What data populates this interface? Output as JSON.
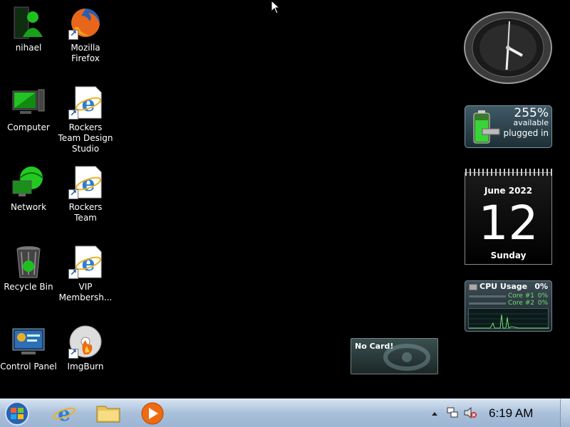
{
  "desktop": {
    "icons": [
      {
        "label": "nihael",
        "icon": "user-folder-icon"
      },
      {
        "label": "Mozilla Firefox",
        "icon": "firefox-icon"
      },
      {
        "label": "Computer",
        "icon": "computer-icon"
      },
      {
        "label": "Rockers Team Design Studio",
        "icon": "internet-explorer-icon"
      },
      {
        "label": "Network",
        "icon": "network-icon"
      },
      {
        "label": "Rockers Team",
        "icon": "internet-explorer-icon"
      },
      {
        "label": "Recycle Bin",
        "icon": "recycle-bin-icon"
      },
      {
        "label": "VIP Membersh...",
        "icon": "internet-explorer-icon"
      },
      {
        "label": "Control Panel",
        "icon": "control-panel-icon"
      },
      {
        "label": "ImgBurn",
        "icon": "imgburn-icon"
      }
    ]
  },
  "gadgets": {
    "battery": {
      "percent": "255%",
      "status1": "available",
      "status2": "plugged in"
    },
    "calendar": {
      "month_year": "June 2022",
      "day": "12",
      "weekday": "Sunday"
    },
    "cpu": {
      "title": "CPU Usage",
      "value": "0%",
      "core1_label": "Core #1",
      "core1_value": "0%",
      "core2_label": "Core #2",
      "core2_value": "0%"
    },
    "gpu": {
      "label": "No Card!"
    }
  },
  "taskbar": {
    "start": "start-orb-icon",
    "pinned": [
      "internet-explorer-icon",
      "file-explorer-icon",
      "media-player-icon"
    ],
    "tray_time": "6:19 AM"
  },
  "colors": {
    "taskbar": "#a9c0da",
    "accent_green": "#1fbf1f"
  }
}
